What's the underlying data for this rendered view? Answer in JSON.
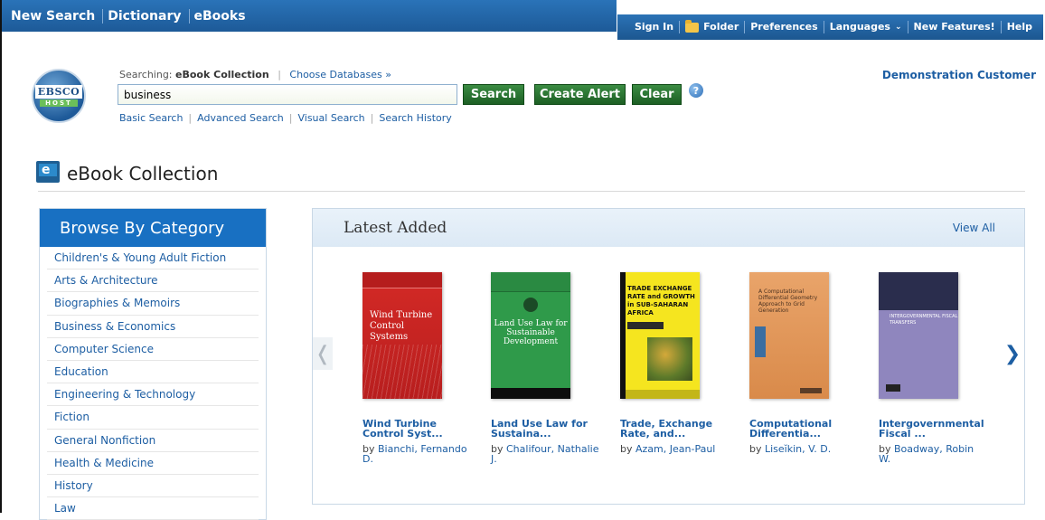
{
  "topnav": {
    "left": [
      "New Search",
      "Dictionary",
      "eBooks"
    ],
    "right": {
      "sign_in": "Sign In",
      "folder": "Folder",
      "preferences": "Preferences",
      "languages": "Languages",
      "new_features": "New Features!",
      "help": "Help"
    }
  },
  "logo": {
    "line1": "EBSCO",
    "line2": "HOST"
  },
  "search": {
    "searching_label": "Searching:",
    "collection": "eBook Collection",
    "choose_databases": "Choose Databases »",
    "query": "business",
    "search_button": "Search",
    "create_alert_button": "Create Alert",
    "clear_button": "Clear",
    "links": [
      "Basic Search",
      "Advanced Search",
      "Visual Search",
      "Search History"
    ]
  },
  "customer": "Demonstration Customer",
  "collection_title": "eBook Collection",
  "browse": {
    "heading": "Browse By Category",
    "categories": [
      "Children's & Young Adult Fiction",
      "Arts & Architecture",
      "Biographies & Memoirs",
      "Business & Economics",
      "Computer Science",
      "Education",
      "Engineering & Technology",
      "Fiction",
      "General Nonfiction",
      "Health & Medicine",
      "History",
      "Law"
    ]
  },
  "latest": {
    "heading": "Latest Added",
    "view_all": "View All",
    "books": [
      {
        "title": "Wind Turbine Control Syst...",
        "by": "by",
        "author": "Bianchi, Fernando D.",
        "cover_text": "Wind Turbine Control Systems"
      },
      {
        "title": "Land Use Law for Sustaina...",
        "by": "by",
        "author": "Chalifour, Nathalie J.",
        "cover_text": "Land Use Law for Sustainable Development"
      },
      {
        "title": "Trade, Exchange Rate, and...",
        "by": "by",
        "author": "Azam, Jean-Paul",
        "cover_text": "TRADE EXCHANGE RATE and GROWTH in SUB-SAHARAN AFRICA"
      },
      {
        "title": "Computational Differentia...",
        "by": "by",
        "author": "Liseĭkin, V. D.",
        "cover_text": "A Computational Differential Geometry Approach to Grid Generation"
      },
      {
        "title": "Intergovernmental Fiscal ...",
        "by": "by",
        "author": "Boadway, Robin W.",
        "cover_text": "INTERGOVERNMENTAL FISCAL TRANSFERS"
      }
    ]
  },
  "icons": {
    "folder": "folder-icon",
    "help": "help-icon",
    "prev": "chevron-left-icon",
    "next": "chevron-right-icon"
  }
}
